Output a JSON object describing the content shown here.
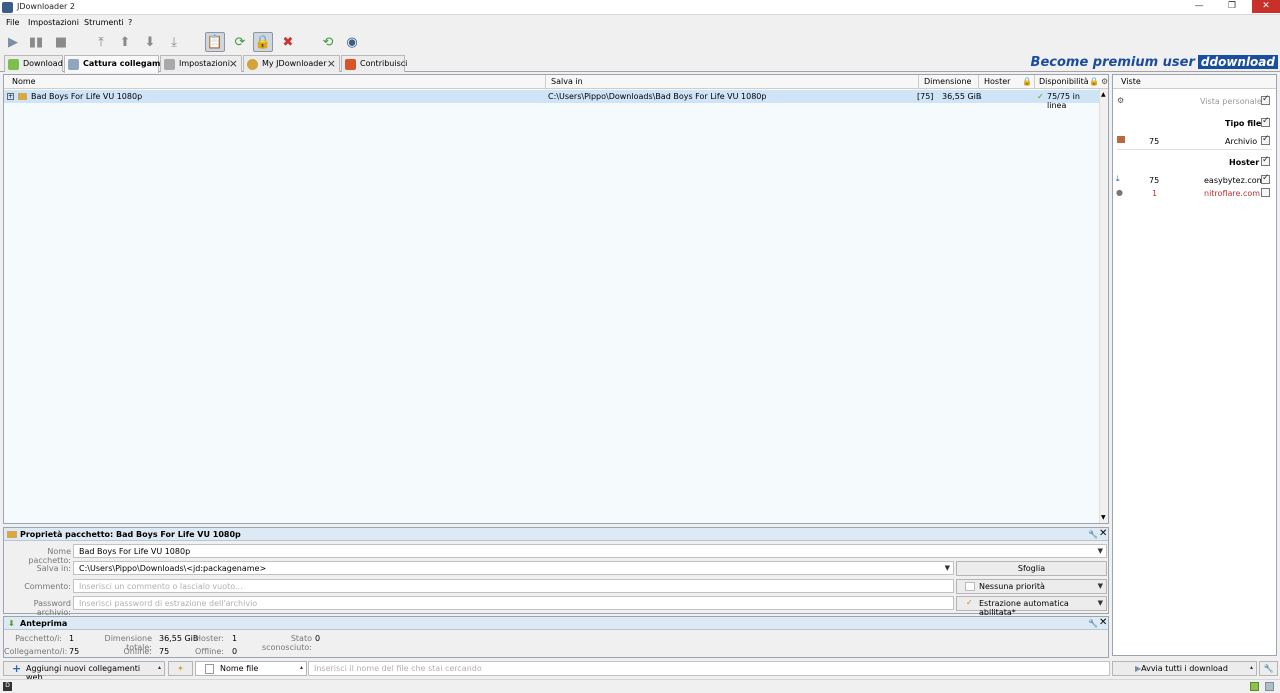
{
  "window": {
    "title": "JDownloader 2",
    "minimize": "—",
    "maximize": "❐",
    "close": "✕"
  },
  "menu": [
    "File",
    "Impostazioni",
    "Strumenti",
    "?"
  ],
  "tabs": [
    {
      "label": "Download",
      "closable": false
    },
    {
      "label": "Cattura collegamenti",
      "closable": false
    },
    {
      "label": "Impostazioni",
      "closable": true
    },
    {
      "label": "My JDownloader",
      "closable": true
    },
    {
      "label": "Contribuisci",
      "closable": false
    }
  ],
  "premium": {
    "text": "Become premium user",
    "brand": "ddownload"
  },
  "columns": {
    "name": "Nome",
    "save_in": "Salva in",
    "size": "Dimensione",
    "hoster": "Hoster",
    "availability": "Disponibilità"
  },
  "package_row": {
    "expander": "+",
    "name": "Bad Boys For Life VU 1080p",
    "save_in": "C:\\Users\\Pippo\\Downloads\\Bad Boys For Life VU 1080p",
    "count": "[75]",
    "size": "36,55 GiB",
    "availability": "75/75 in linea"
  },
  "sidebar": {
    "header": "Viste",
    "personal_view": "Vista personale",
    "file_type_heading": "Tipo file",
    "file_type": {
      "count": "75",
      "label": "Archivio"
    },
    "hoster_heading": "Hoster",
    "hosters": [
      {
        "count": "75",
        "label": "easybytez.com",
        "checked": true
      },
      {
        "count": "1",
        "label": "nitroflare.com",
        "checked": false
      }
    ]
  },
  "properties": {
    "title": "Proprietà pacchetto: Bad Boys For Life VU 1080p",
    "name_label": "Nome pacchetto:",
    "name_value": "Bad Boys For Life VU 1080p",
    "save_label": "Salva in:",
    "save_value": "C:\\Users\\Pippo\\Downloads\\<jd:packagename>",
    "browse": "Sfoglia",
    "comment_label": "Commento:",
    "comment_placeholder": "Inserisci un commento o lascialo vuoto...",
    "priority": "Nessuna priorità",
    "password_label": "Password archivio:",
    "password_placeholder": "Inserisci password di estrazione dell'archivio",
    "extraction": "Estrazione automatica abilitata*"
  },
  "preview": {
    "title": "Anteprima",
    "packages_label": "Pacchetto/i:",
    "packages": "1",
    "total_size_label": "Dimensione totale:",
    "total_size": "36,55 GiB",
    "hoster_label": "Hoster:",
    "hoster": "1",
    "unknown_label": "Stato sconosciuto:",
    "unknown": "0",
    "links_label": "Collegamento/i:",
    "links": "75",
    "online_label": "Online:",
    "online": "75",
    "offline_label": "Offline:",
    "offline": "0"
  },
  "bottom": {
    "add_links": "Aggiungi nuovi collegamenti web...",
    "filename_filter": "Nome file",
    "search_placeholder": "Inserisci il nome del file che stai cercando",
    "start_all": "Avvia tutti i download"
  }
}
